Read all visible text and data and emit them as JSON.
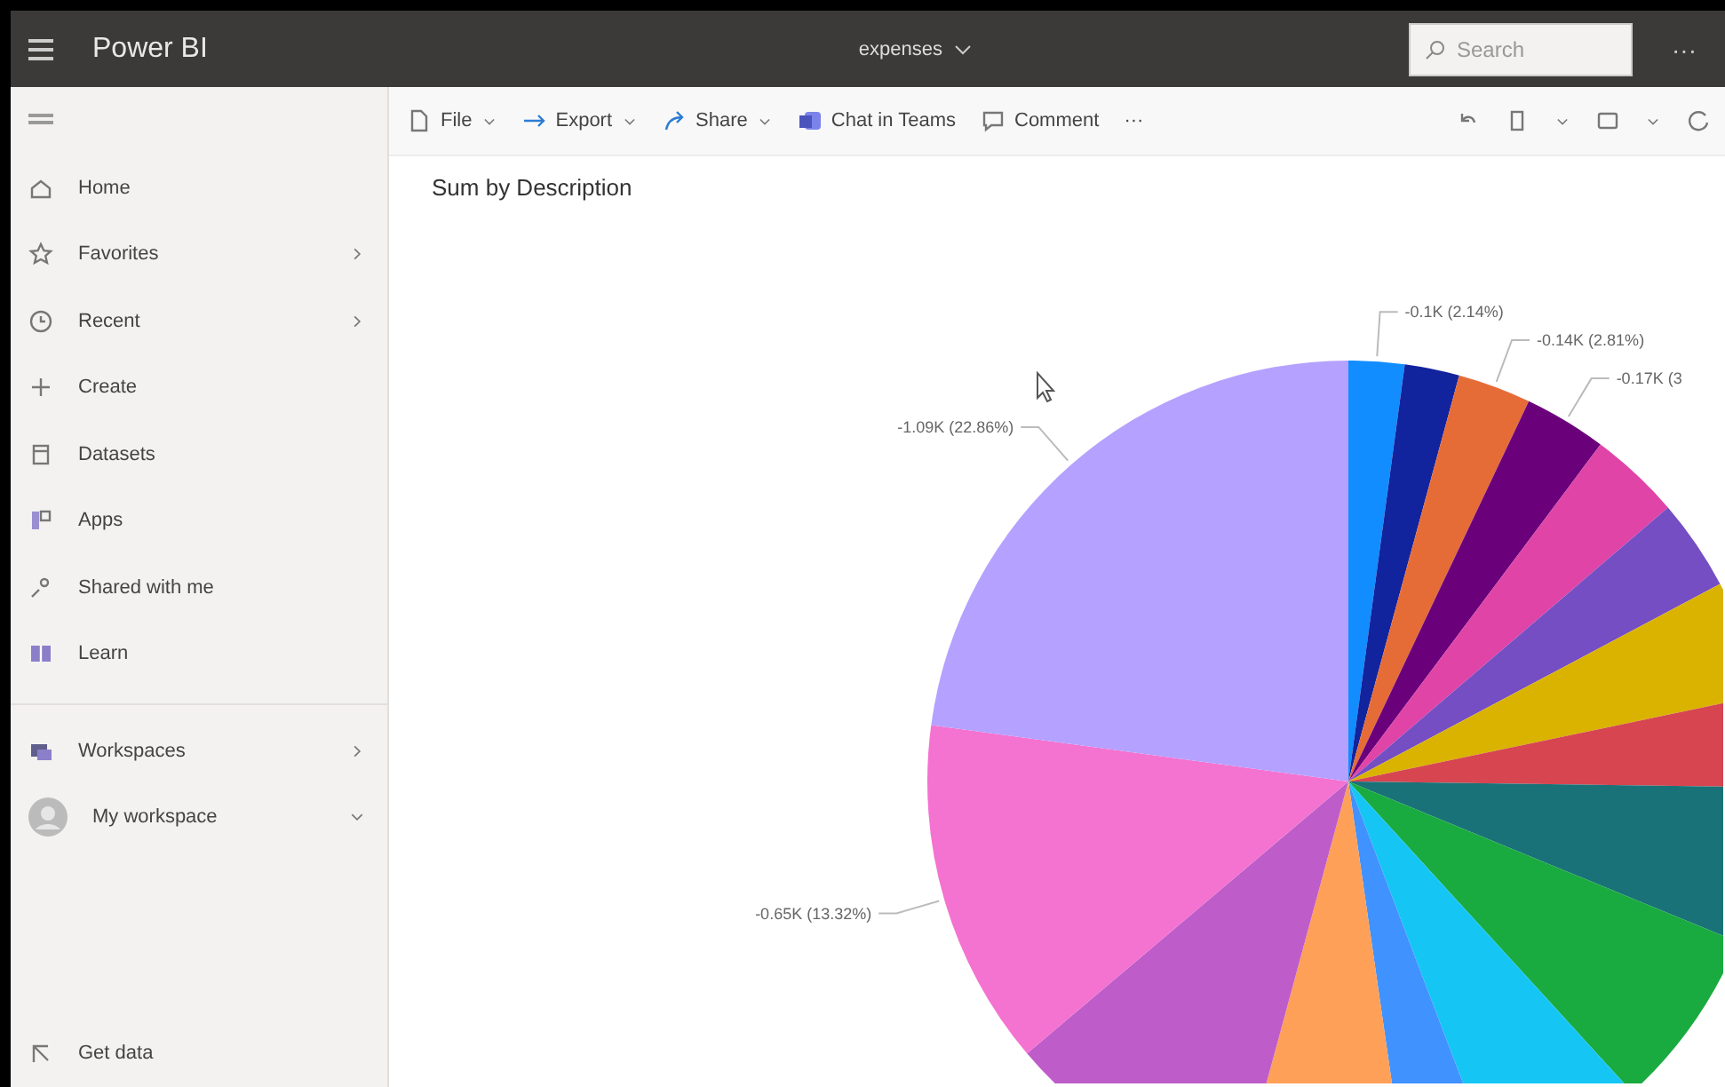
{
  "top_bar": {
    "app_name": "Power BI",
    "report_name": "expenses",
    "search": {
      "placeholder": "Search"
    },
    "more": "···"
  },
  "toolbar": {
    "items": [
      {
        "kind": "file",
        "label": "File",
        "dropdown": true
      },
      {
        "kind": "export",
        "label": "Export",
        "dropdown": true
      },
      {
        "kind": "share",
        "label": "Share",
        "dropdown": true
      },
      {
        "kind": "teams",
        "label": "Chat in Teams",
        "dropdown": false
      },
      {
        "kind": "comment",
        "label": "Comment",
        "dropdown": false
      }
    ],
    "more": "···"
  },
  "sidebar": {
    "items": [
      {
        "kind": "home",
        "label": "Home",
        "has_submenu": false
      },
      {
        "kind": "star",
        "label": "Favorites",
        "has_submenu": true
      },
      {
        "kind": "clock",
        "label": "Recent",
        "has_submenu": true
      },
      {
        "kind": "plus",
        "label": "Create",
        "has_submenu": false
      },
      {
        "kind": "dataset",
        "label": "Datasets",
        "has_submenu": false
      },
      {
        "kind": "apps",
        "label": "Apps",
        "has_submenu": false
      },
      {
        "kind": "shared",
        "label": "Shared with me",
        "has_submenu": false
      },
      {
        "kind": "learn",
        "label": "Learn",
        "has_submenu": false
      }
    ],
    "workspace_items": [
      {
        "kind": "workspaces",
        "label": "Workspaces",
        "has_submenu": true
      },
      {
        "kind": "avatar",
        "label": "My workspace",
        "has_submenu": false,
        "expanded": false
      }
    ],
    "footer": {
      "label": "Get data"
    }
  },
  "visual": {
    "chart_data": {
      "type": "pie",
      "title": "Sum by Description",
      "series": [
        {
          "values": [
            2.14,
            2.1,
            2.81,
            3.17,
            3.5,
            3.5,
            4.5,
            3.5,
            6,
            7,
            6,
            3.5,
            6.5,
            9.6,
            13.32,
            22.86
          ]
        }
      ],
      "colors": [
        "#118dff",
        "#12239e",
        "#e66c37",
        "#6b007b",
        "#e044a7",
        "#744ec2",
        "#d9b300",
        "#d64550",
        "#197278",
        "#1aab40",
        "#15c6f4",
        "#4092ff",
        "#ffa058",
        "#be5dc9",
        "#f472d0",
        "#b5a1ff"
      ],
      "value_labels": [
        "-0.1K (2.14%)",
        null,
        "-0.14K (2.81%)",
        "-0.17K (3",
        null,
        null,
        null,
        null,
        null,
        null,
        null,
        null,
        null,
        null,
        "-0.65K (13.32%)",
        "-1.09K (22.86%)"
      ]
    }
  }
}
